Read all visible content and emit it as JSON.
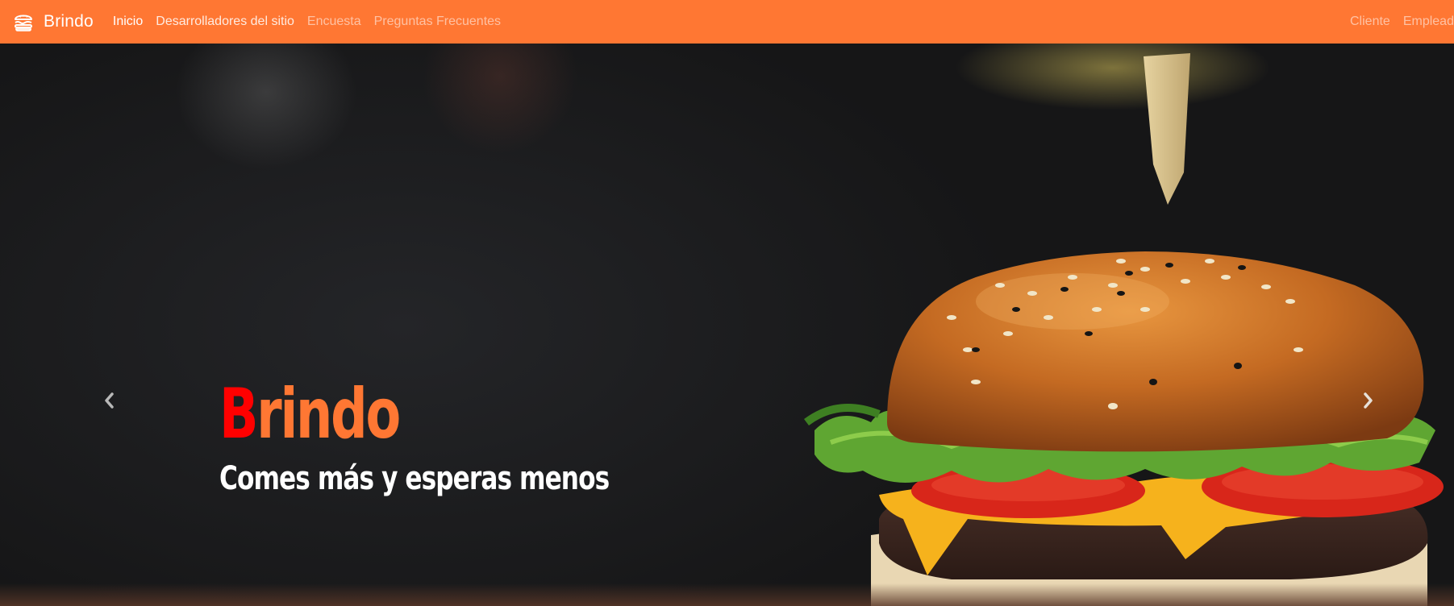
{
  "navbar": {
    "brand": "Brindo",
    "brand_icon": "hamburger-icon",
    "links": [
      {
        "label": "Inicio",
        "state": "active"
      },
      {
        "label": "Desarrolladores del sitio",
        "state": "normal"
      },
      {
        "label": "Encuesta",
        "state": "muted"
      },
      {
        "label": "Preguntas Frecuentes",
        "state": "muted"
      }
    ],
    "right_links": [
      {
        "label": "Cliente"
      },
      {
        "label": "Empleado"
      }
    ],
    "background_color": "#ff7733"
  },
  "hero": {
    "title_first_letter": "B",
    "title_rest": "rindo",
    "title_first_color": "#ff0000",
    "title_color": "#ff7733",
    "subtitle": "Comes más y esperas menos",
    "prev_icon": "chevron-left-icon",
    "next_icon": "chevron-right-icon",
    "image": "burger-photo"
  }
}
